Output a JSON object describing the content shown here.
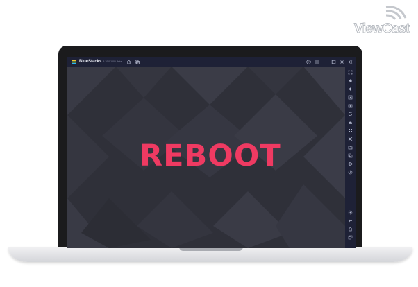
{
  "watermark": {
    "text": "ViewCast",
    "icon": "wifi-signal-icon"
  },
  "window": {
    "app_name": "BlueStacks",
    "version_label": "5.10.0.1006 Beta",
    "title_icons": [
      "home-icon",
      "multi-instance-icon"
    ],
    "controls": [
      "help-icon",
      "menu-icon",
      "minimize-icon",
      "maximize-icon",
      "close-icon"
    ],
    "back_icon": "collapse-sidebar-icon"
  },
  "game": {
    "title": "REBOOT",
    "title_color": "#ef3a62",
    "background_color": "#2f3039"
  },
  "sidebar": {
    "top_items": [
      "fullscreen-icon",
      "volume-up-icon",
      "volume-down-icon",
      "video-record-icon",
      "screenshot-icon",
      "rotate-icon",
      "shake-icon",
      "controls-icon",
      "macro-icon",
      "folder-icon",
      "multi-instance-icon",
      "eco-mode-icon",
      "sync-icon"
    ],
    "bottom_items": [
      "settings-icon",
      "back-icon",
      "home-icon",
      "recent-apps-icon"
    ]
  },
  "colors": {
    "titlebar": "#1e2136",
    "accent": "#ef3a62",
    "icon": "#aeb3c8"
  }
}
